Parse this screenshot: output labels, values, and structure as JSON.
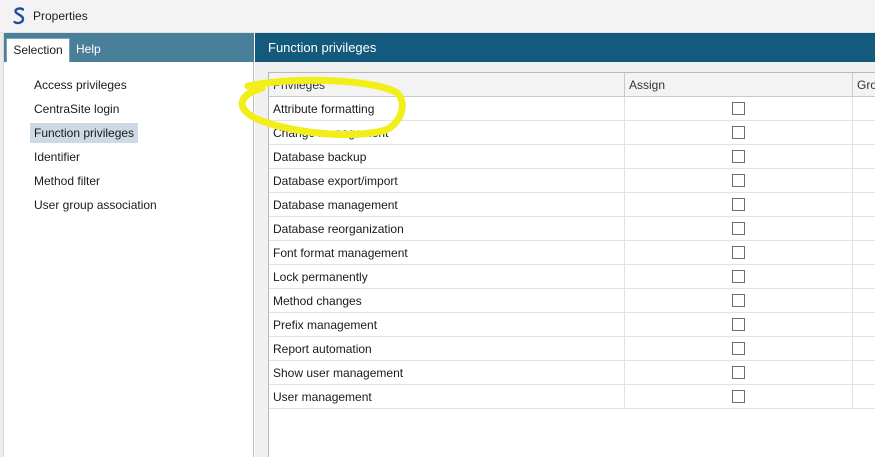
{
  "window": {
    "title": "Properties",
    "logo_icon": "app-s-logo-icon"
  },
  "tabs": [
    {
      "label": "Selection",
      "active": true
    },
    {
      "label": "Help",
      "active": false
    }
  ],
  "nav": {
    "items": [
      {
        "label": "Access privileges"
      },
      {
        "label": "CentraSite login"
      },
      {
        "label": "Function privileges",
        "selected": true
      },
      {
        "label": "Identifier"
      },
      {
        "label": "Method filter"
      },
      {
        "label": "User group association"
      }
    ]
  },
  "panel": {
    "title": "Function privileges",
    "columns": {
      "privileges": "Privileges",
      "assign": "Assign",
      "group": "Gro"
    },
    "rows": [
      {
        "name": "Attribute formatting",
        "assigned": false
      },
      {
        "name": "Change management",
        "assigned": false
      },
      {
        "name": "Database backup",
        "assigned": false
      },
      {
        "name": "Database export/import",
        "assigned": false
      },
      {
        "name": "Database management",
        "assigned": false
      },
      {
        "name": "Database reorganization",
        "assigned": false
      },
      {
        "name": "Font format management",
        "assigned": false
      },
      {
        "name": "Lock permanently",
        "assigned": false
      },
      {
        "name": "Method changes",
        "assigned": false
      },
      {
        "name": "Prefix management",
        "assigned": false
      },
      {
        "name": "Report automation",
        "assigned": false
      },
      {
        "name": "Show user management",
        "assigned": false
      },
      {
        "name": "User management",
        "assigned": false
      }
    ]
  },
  "colors": {
    "left_header": "#4a7f99",
    "right_header": "#145a7d",
    "selected_item": "#cdd9e4",
    "annotation": "#f2ee1a"
  }
}
